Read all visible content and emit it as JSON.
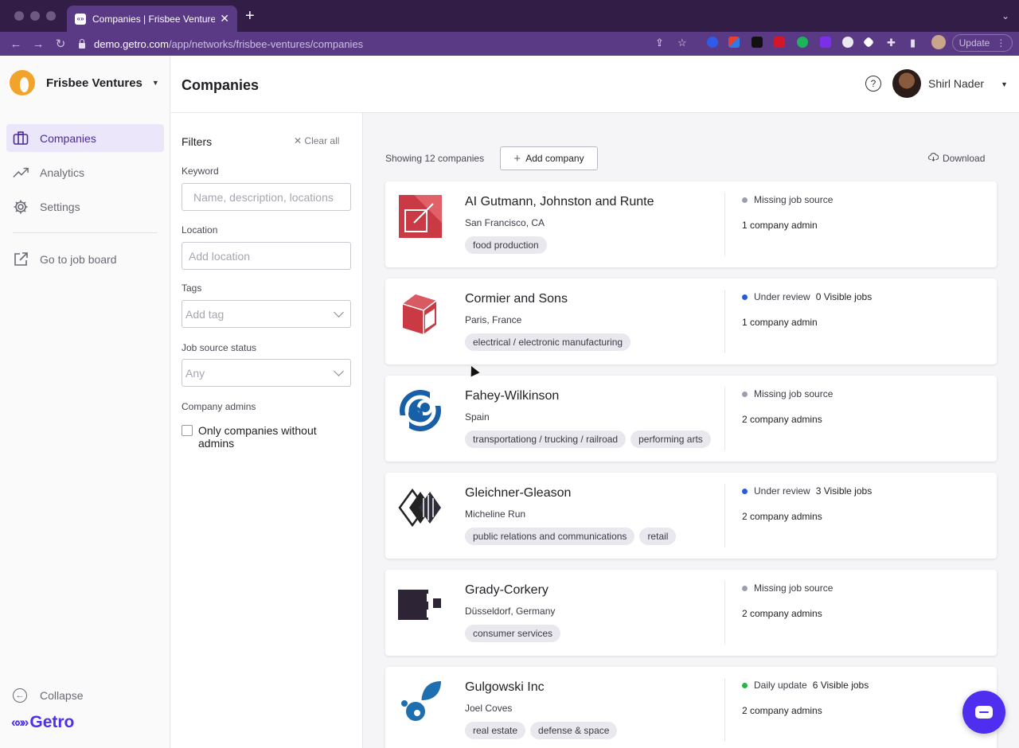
{
  "browser": {
    "tab_title": "Companies | Frisbee Ventures |",
    "url_host": "demo.getro.com",
    "url_path": "/app/networks/frisbee-ventures/companies",
    "update_label": "Update"
  },
  "sidebar": {
    "brand": "Frisbee Ventures",
    "items": [
      {
        "label": "Companies",
        "icon": "briefcase-icon"
      },
      {
        "label": "Analytics",
        "icon": "trend-icon"
      },
      {
        "label": "Settings",
        "icon": "gear-icon"
      },
      {
        "label": "Go to job board",
        "icon": "external-link-icon"
      }
    ],
    "collapse_label": "Collapse",
    "footer_logo": "Getro"
  },
  "header": {
    "title": "Companies",
    "user_name": "Shirl Nader"
  },
  "filters": {
    "title": "Filters",
    "clear_all": "Clear all",
    "keyword_label": "Keyword",
    "keyword_placeholder": "Name, description, locations",
    "location_label": "Location",
    "location_placeholder": "Add location",
    "tags_label": "Tags",
    "tags_placeholder": "Add tag",
    "job_source_label": "Job source status",
    "job_source_value": "Any",
    "admins_label": "Company admins",
    "admins_checkbox": "Only companies without admins"
  },
  "list": {
    "showing": "Showing 12 companies",
    "add_company": "Add company",
    "download": "Download"
  },
  "colors": {
    "status_grey": "#9aa0ab",
    "status_blue": "#2a5bd7",
    "status_green": "#2bb24c",
    "accent": "#4f2ef0"
  },
  "companies": [
    {
      "name": "AI Gutmann, Johnston and Runte",
      "location": "San Francisco, CA",
      "tags": [
        "food production"
      ],
      "status": "Missing job source",
      "status_color": "#9aa0ab",
      "visible_jobs": "",
      "admins": "1 company admin",
      "logo": "red-square-logo"
    },
    {
      "name": "Cormier and Sons",
      "location": "Paris, France",
      "tags": [
        "electrical / electronic manufacturing"
      ],
      "status": "Under review",
      "status_color": "#2a5bd7",
      "visible_jobs": "0 Visible jobs",
      "admins": "1 company admin",
      "logo": "red-cube-logo"
    },
    {
      "name": "Fahey-Wilkinson",
      "location": "Spain",
      "tags": [
        "transportationg / trucking / railroad",
        "performing arts"
      ],
      "status": "Missing job source",
      "status_color": "#9aa0ab",
      "visible_jobs": "",
      "admins": "2 company admins",
      "logo": "blue-swirl-logo"
    },
    {
      "name": "Gleichner-Gleason",
      "location": "Micheline Run",
      "tags": [
        "public relations and communications",
        "retail"
      ],
      "status": "Under review",
      "status_color": "#2a5bd7",
      "visible_jobs": "3 Visible jobs",
      "admins": "2 company admins",
      "logo": "diamonds-logo"
    },
    {
      "name": "Grady-Corkery",
      "location": "Düsseldorf, Germany",
      "tags": [
        "consumer services"
      ],
      "status": "Missing job source",
      "status_color": "#9aa0ab",
      "visible_jobs": "",
      "admins": "2 company admins",
      "logo": "dark-blocks-logo"
    },
    {
      "name": "Gulgowski Inc",
      "location": "Joel Coves",
      "tags": [
        "real estate",
        "defense & space"
      ],
      "status": "Daily update",
      "status_color": "#2bb24c",
      "visible_jobs": "6 Visible jobs",
      "admins": "2 company admins",
      "logo": "blue-drops-logo"
    }
  ]
}
